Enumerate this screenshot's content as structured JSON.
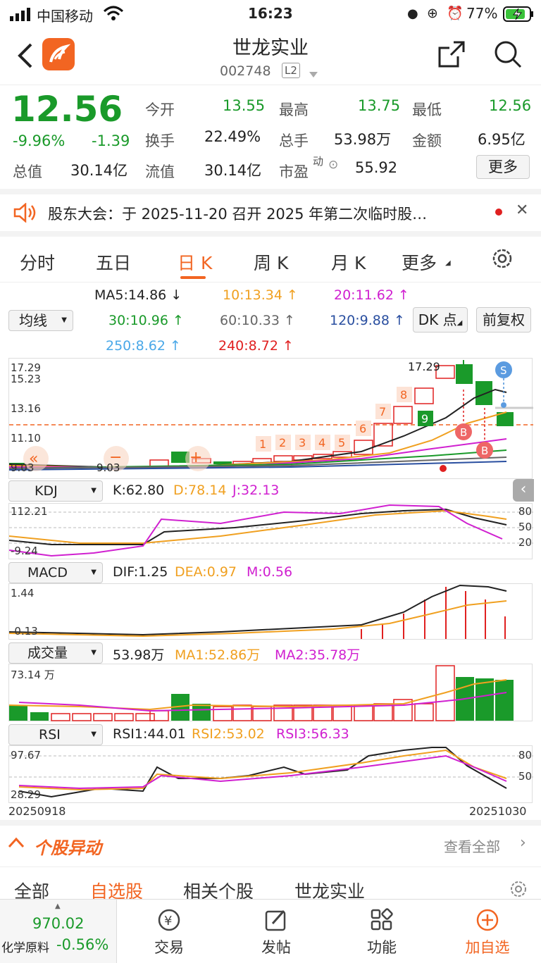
{
  "status": {
    "carrier": "中国移动",
    "time": "16:23",
    "battery": "77%"
  },
  "stock": {
    "name": "世龙实业",
    "code": "002748",
    "level": "L2"
  },
  "quote": {
    "price": "12.56",
    "pct": "-9.96%",
    "change": "-1.39",
    "open_label": "今开",
    "open": "13.55",
    "high_label": "最高",
    "high": "13.75",
    "low_label": "最低",
    "low": "12.56",
    "turnover_label": "换手",
    "turnover": "22.49%",
    "vol_label": "总手",
    "vol": "53.98万",
    "amt_label": "金额",
    "amt": "6.95亿",
    "mcap_label": "总值",
    "mcap": "30.14亿",
    "fcap_label": "流值",
    "fcap": "30.14亿",
    "pe_label": "市盈",
    "pe_sup": "动",
    "pe": "55.92",
    "more": "更多"
  },
  "notice": {
    "text": "股东大会：于 2025-11-20 召开 2025 年第二次临时股…"
  },
  "tabs": [
    "分时",
    "五日",
    "日 K",
    "周 K",
    "月 K",
    "更多"
  ],
  "active_tab": "日 K",
  "ma": {
    "select": "均线",
    "ma5": "MA5:14.86 ↓",
    "ma10": "10:13.34 ↑",
    "ma20": "20:11.62 ↑",
    "ma30": "30:10.96 ↑",
    "ma60": "60:10.33 ↑",
    "ma120": "120:9.88 ↑",
    "ma250": "250:8.62 ↑",
    "ma240": "240:8.72 ↑",
    "dk": "DK 点",
    "fq": "前复权"
  },
  "kaxis": {
    "y1": "17.29",
    "y2": "15.23",
    "y3": "13.16",
    "y4": "11.10",
    "y5": "9.03",
    "hi_label": "17.29",
    "min_label": "9.03"
  },
  "kdj": {
    "name": "KDJ",
    "k": "K:62.80",
    "d": "D:78.14",
    "j": "J:32.13",
    "y_top": "112.21",
    "y_bot": "-9.24",
    "l80": "80",
    "l50": "50",
    "l20": "20"
  },
  "macd": {
    "name": "MACD",
    "dif": "DIF:1.25",
    "dea": "DEA:0.97",
    "m": "M:0.56",
    "y_top": "1.44",
    "y_bot": "-0.13"
  },
  "vol": {
    "name": "成交量",
    "v": "53.98万",
    "ma1": "MA1:52.86万",
    "ma2": "MA2:35.78万",
    "y_top": "73.14 万"
  },
  "rsi": {
    "name": "RSI",
    "r1": "RSI1:44.01",
    "r2": "RSI2:53.02",
    "r3": "RSI3:56.33",
    "y_top": "97.67",
    "y_bot": "28.29",
    "l80": "80",
    "l50": "50"
  },
  "dates": {
    "start": "20250918",
    "end": "20251030"
  },
  "section": {
    "title": "个股异动",
    "view_all": "查看全部"
  },
  "subtabs": [
    "全部",
    "自选股",
    "相关个股",
    "世龙实业"
  ],
  "bottom": {
    "index_value": "970.02",
    "index_name": "化学原料",
    "index_pct": "-0.56%",
    "trade": "交易",
    "post": "发帖",
    "func": "功能",
    "add": "加自选"
  },
  "colors": {
    "up": "#e02020",
    "down": "#1a9a2a",
    "accent": "#f26522"
  },
  "chart_data": {
    "type": "candlestick",
    "x": [
      "20250918",
      "20251030"
    ],
    "ylim": [
      9.03,
      17.29
    ],
    "signals": [
      "1",
      "2",
      "3",
      "4",
      "5",
      "6",
      "7",
      "8",
      "9",
      "B",
      "B",
      "S"
    ]
  }
}
